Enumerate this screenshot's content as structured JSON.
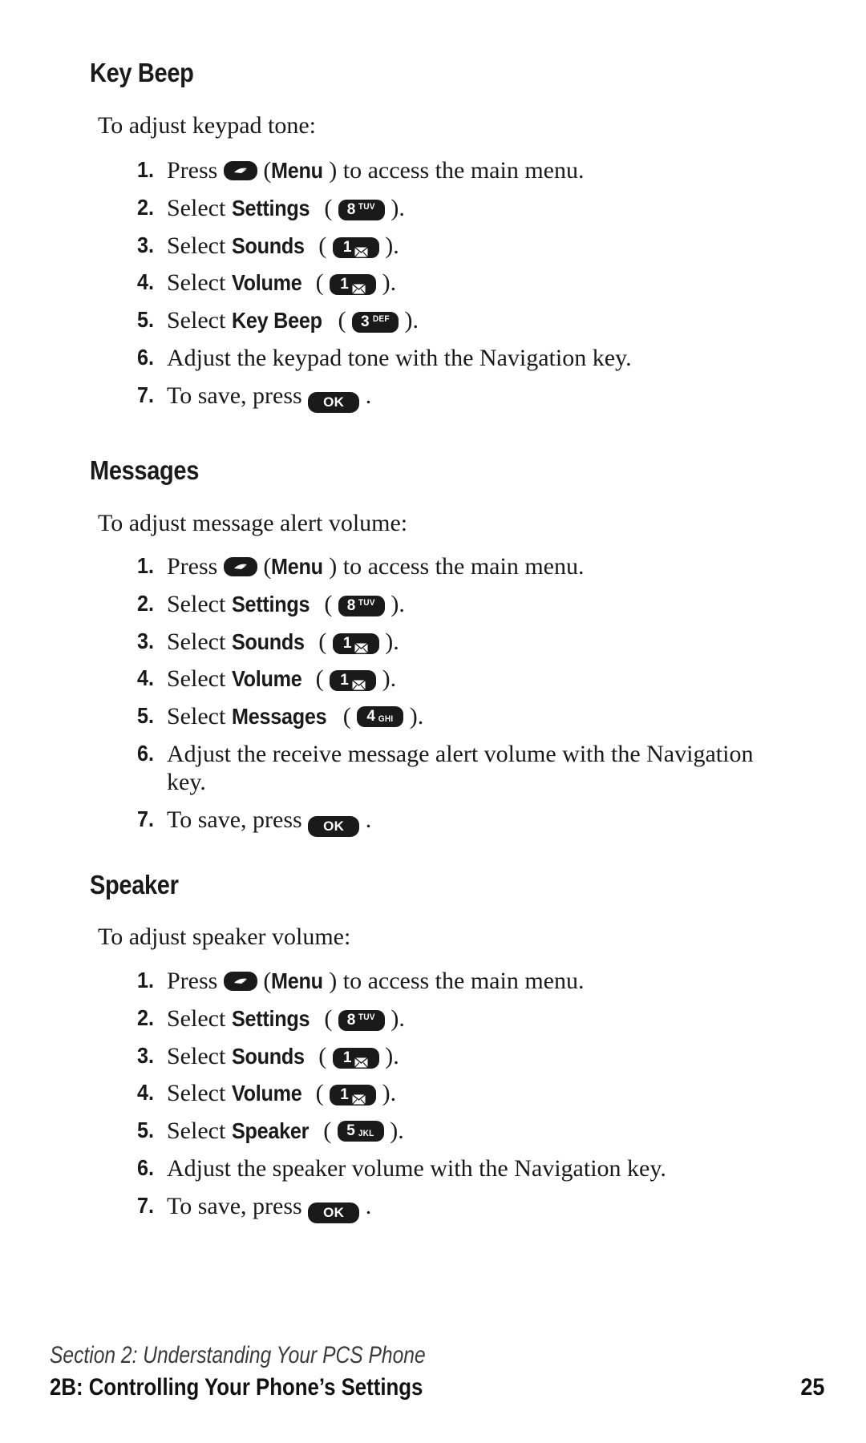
{
  "document": {
    "type": "phone-user-guide-page",
    "page_number": "25"
  },
  "sections": [
    {
      "heading": "Key Beep",
      "intro": "To adjust keypad tone:",
      "steps": [
        {
          "number": "1.",
          "pre": "Press ",
          "key": "menu",
          "post_bold": "",
          "post": " (Menu) to access the main menu."
        },
        {
          "number": "2.",
          "pre": "Select ",
          "bold": "Settings",
          "key": "8tuv",
          "post": "."
        },
        {
          "number": "3.",
          "pre": "Select ",
          "bold": "Sounds",
          "key": "1env",
          "post": "."
        },
        {
          "number": "4.",
          "pre": "Select ",
          "bold": "Volume",
          "key": "1env",
          "post": "."
        },
        {
          "number": "5.",
          "pre": "Select ",
          "bold": "Key Beep",
          "key": "3def",
          "post": "."
        },
        {
          "number": "6.",
          "text": "Adjust the keypad tone with the Navigation key."
        },
        {
          "number": "7.",
          "pre": "To save, press ",
          "key": "ok",
          "post": " ."
        }
      ]
    },
    {
      "heading": "Messages",
      "intro": "To adjust message alert volume:",
      "steps": [
        {
          "number": "1.",
          "pre": "Press ",
          "key": "menu",
          "post": " (Menu) to access the main menu."
        },
        {
          "number": "2.",
          "pre": "Select ",
          "bold": "Settings",
          "key": "8tuv",
          "post": "."
        },
        {
          "number": "3.",
          "pre": "Select ",
          "bold": "Sounds",
          "key": "1env",
          "post": "."
        },
        {
          "number": "4.",
          "pre": "Select ",
          "bold": "Volume",
          "key": "1env",
          "post": "."
        },
        {
          "number": "5.",
          "pre": "Select ",
          "bold": "Messages",
          "key": "4ghi",
          "post": "."
        },
        {
          "number": "6.",
          "text": "Adjust the receive message alert volume with the Navigation key."
        },
        {
          "number": "7.",
          "pre": "To save, press ",
          "key": "ok",
          "post": " ."
        }
      ]
    },
    {
      "heading": "Speaker",
      "intro": "To adjust speaker volume:",
      "steps": [
        {
          "number": "1.",
          "pre": "Press ",
          "key": "menu",
          "post": " (Menu) to access the main menu."
        },
        {
          "number": "2.",
          "pre": "Select ",
          "bold": "Settings",
          "key": "8tuv",
          "post": "."
        },
        {
          "number": "3.",
          "pre": "Select ",
          "bold": "Sounds",
          "key": "1env",
          "post": "."
        },
        {
          "number": "4.",
          "pre": "Select ",
          "bold": "Volume",
          "key": "1env",
          "post": "."
        },
        {
          "number": "5.",
          "pre": "Select ",
          "bold": "Speaker",
          "key": "5jkl",
          "post": "."
        },
        {
          "number": "6.",
          "text": "Adjust the speaker volume with the Navigation key."
        },
        {
          "number": "7.",
          "pre": "To save, press ",
          "key": "ok",
          "post": " ."
        }
      ]
    }
  ],
  "keys": {
    "menu": {
      "label": "Menu",
      "glyph": "soft-key-swoosh",
      "digit": "",
      "letters": ""
    },
    "8tuv": {
      "label": "8 TUV",
      "digit": "8",
      "letters": "TUV",
      "align": "sup"
    },
    "1env": {
      "label": "1 envelope",
      "digit": "1",
      "letters": "",
      "glyph": "envelope"
    },
    "3def": {
      "label": "3 DEF",
      "digit": "3",
      "letters": "DEF",
      "align": "sup"
    },
    "4ghi": {
      "label": "4 GHI",
      "digit": "4",
      "letters": "GHI",
      "align": "sub"
    },
    "5jkl": {
      "label": "5 JKL",
      "digit": "5",
      "letters": "JKL",
      "align": "sub"
    },
    "ok": {
      "label": "OK",
      "digit": "",
      "letters": "OK"
    }
  },
  "footer": {
    "section": "Section 2: Understanding Your PCS Phone",
    "title": "2B: Controlling Your Phone’s Settings",
    "page": "25"
  },
  "colors": {
    "ink": "#1a1a1a",
    "paper": "#ffffff",
    "key_fill": "#1a1a1a",
    "key_text": "#ffffff"
  }
}
